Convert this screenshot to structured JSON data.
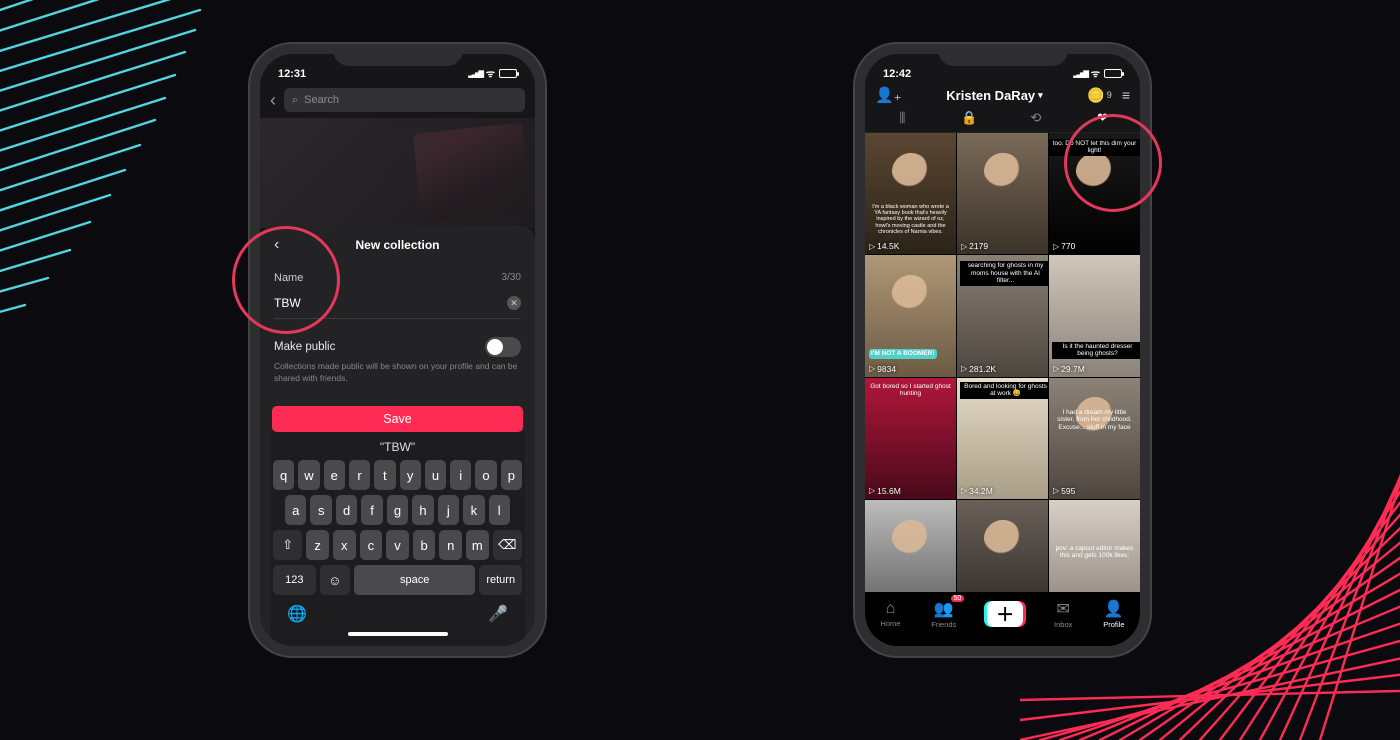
{
  "phone1": {
    "status_time": "12:31",
    "search_placeholder": "Search",
    "sheet": {
      "title": "New collection",
      "name_label": "Name",
      "counter": "3/30",
      "name_value": "TBW",
      "public_label": "Make public",
      "public_hint": "Collections made public will be shown on your profile and can be shared with friends.",
      "save_label": "Save"
    },
    "keyboard": {
      "suggestion": "\"TBW\"",
      "rows": [
        [
          "q",
          "w",
          "e",
          "r",
          "t",
          "y",
          "u",
          "i",
          "o",
          "p"
        ],
        [
          "a",
          "s",
          "d",
          "f",
          "g",
          "h",
          "j",
          "k",
          "l"
        ],
        [
          "⇧",
          "z",
          "x",
          "c",
          "v",
          "b",
          "n",
          "m",
          "⌫"
        ]
      ],
      "numkey": "123",
      "space": "space",
      "returnkey": "return"
    }
  },
  "phone2": {
    "status_time": "12:42",
    "profile_name": "Kristen DaRay",
    "coin_count": "9",
    "friends_badge": "50",
    "tiles": [
      {
        "views": "14.5K",
        "caption": "I'm a black woman who wrote a YA fantasy book that's heavily inspired by the wizard of oz, howl's moving castle and the chronicles of Narnia vibes.",
        "cap_style": "bottom:18px;left:2px;right:2px;font-size:5.5px;"
      },
      {
        "views": "2179",
        "caption": "",
        "cap_style": ""
      },
      {
        "views": "770",
        "caption": "too. Do NOT let this dim your light!",
        "cap_style": "top:6px;left:0;right:0;",
        "cap_class": "blackcap"
      },
      {
        "views": "9834",
        "caption": "I'M NOT A BOOMER!",
        "cap_style": "bottom:18px;left:4px;",
        "cap_class": "pill"
      },
      {
        "views": "281.2K",
        "caption": "searching for ghosts in my moms house with the AI filter...",
        "cap_style": "top:6px;left:3px;right:3px;",
        "cap_class": "blackcap"
      },
      {
        "views": "29.7M",
        "caption": "Is it the haunted dresser being ghosts?",
        "cap_style": "bottom:18px;left:3px;right:3px;",
        "cap_class": "blackcap"
      },
      {
        "views": "15.6M",
        "caption": "Got bored so I started ghost hunting",
        "cap_style": "top:4px;left:3px;right:3px;"
      },
      {
        "views": "34.2M",
        "caption": "Bored and looking for ghosts at work 😅",
        "cap_style": "top:4px;left:3px;right:3px;",
        "cap_class": "blackcap"
      },
      {
        "views": "595",
        "caption": "I had a dream my little sister, from her childhood. Excuse... stuff in my face",
        "cap_style": "top:30px;left:3px;right:3px;"
      },
      {
        "views": "",
        "caption": "",
        "cap_style": ""
      },
      {
        "views": "",
        "caption": "",
        "cap_style": ""
      },
      {
        "views": "",
        "caption": "pov: a capcut editor makes this and gets 100k likes:",
        "cap_style": "top:44px;left:3px;right:3px;"
      }
    ],
    "nav": {
      "home": "Home",
      "friends": "Friends",
      "inbox": "Inbox",
      "profile": "Profile"
    }
  }
}
